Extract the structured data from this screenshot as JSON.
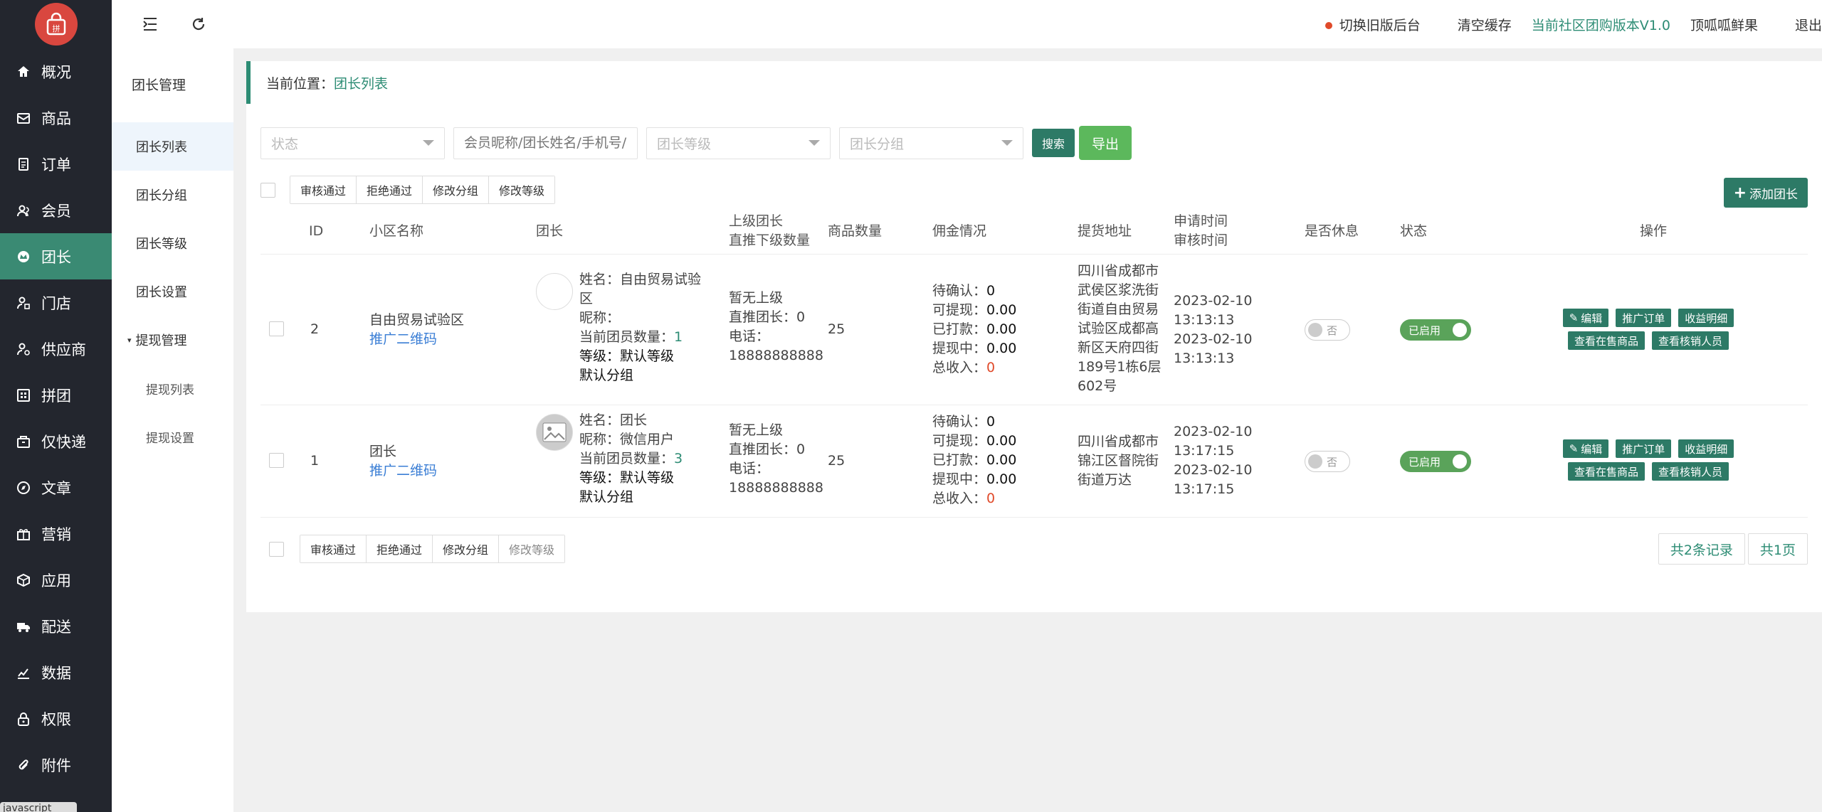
{
  "sidebar": {
    "items": [
      {
        "label": "概况",
        "icon": "home-icon"
      },
      {
        "label": "商品",
        "icon": "product-icon"
      },
      {
        "label": "订单",
        "icon": "order-icon"
      },
      {
        "label": "会员",
        "icon": "member-icon"
      },
      {
        "label": "团长",
        "icon": "leader-icon",
        "active": true
      },
      {
        "label": "门店",
        "icon": "store-icon"
      },
      {
        "label": "供应商",
        "icon": "supplier-icon"
      },
      {
        "label": "拼团",
        "icon": "groupbuy-icon"
      },
      {
        "label": "仅快递",
        "icon": "express-icon"
      },
      {
        "label": "文章",
        "icon": "article-icon"
      },
      {
        "label": "营销",
        "icon": "gift-icon"
      },
      {
        "label": "应用",
        "icon": "app-icon"
      },
      {
        "label": "配送",
        "icon": "truck-icon"
      },
      {
        "label": "数据",
        "icon": "chart-icon"
      },
      {
        "label": "权限",
        "icon": "lock-icon"
      },
      {
        "label": "附件",
        "icon": "attachment-icon"
      }
    ],
    "logo_text": "拼",
    "tooltip_stub": "javascript"
  },
  "submenu": {
    "title": "团长管理",
    "items": [
      "团长列表",
      "团长分组",
      "团长等级",
      "团长设置"
    ],
    "group": "提现管理",
    "group_children": [
      "提现列表",
      "提现设置"
    ]
  },
  "topbar": {
    "switch_old": "切换旧版后台",
    "clear_cache": "清空缓存",
    "version": "当前社区团购版本V1.0",
    "shop": "顶呱呱鲜果",
    "logout": "退出"
  },
  "breadcrumb": {
    "prefix": "当前位置：",
    "current": "团长列表"
  },
  "filters": {
    "status": "状态",
    "keyword_placeholder": "会员昵称/团长姓名/手机号/小区名称",
    "level": "团长等级",
    "group": "团长分组",
    "search": "搜索",
    "export": "导出"
  },
  "bulk": {
    "approve": "审核通过",
    "reject": "拒绝通过",
    "modify_group": "修改分组",
    "modify_level": "修改等级"
  },
  "add_button": "添加团长",
  "columns": {
    "id": "ID",
    "community": "小区名称",
    "leader": "团长",
    "upper_1": "上级团长",
    "upper_2": "直推下级数量",
    "goods_count": "商品数量",
    "commission": "佣金情况",
    "address": "提货地址",
    "time_1": "申请时间",
    "time_2": "审核时间",
    "rest": "是否休息",
    "status": "状态",
    "ops": "操作"
  },
  "rows": [
    {
      "id": "2",
      "community": "自由贸易试验区",
      "qrcode": "推广二维码",
      "name_line1": "姓名：自由贸易试验",
      "name_line2": "区",
      "nickname": "昵称：",
      "members_label": "当前团员数量：",
      "members": "1",
      "level_label": "等级：",
      "level": "默认等级",
      "group": "默认分组",
      "upper": "暂无上级",
      "direct_label": "直推团长：",
      "direct": "0",
      "phone_label": "电话：",
      "phone": "18888888888",
      "goods": "25",
      "pending_label": "待确认：",
      "pending": "0",
      "withdrawable_label": "可提现：",
      "withdrawable": "0.00",
      "paid_label": "已打款：",
      "paid": "0.00",
      "withdrawing_label": "提现中：",
      "withdrawing": "0.00",
      "total_label": "总收入：",
      "total": "0",
      "address_lines": [
        "四川省成都市",
        "武侯区浆洗街",
        "街道自由贸易",
        "试验区成都高",
        "新区天府四街",
        "189号1栋6层",
        "602号"
      ],
      "apply_date": "2023-02-10",
      "apply_time": "13:13:13",
      "audit_date": "2023-02-10",
      "audit_time": "13:13:13",
      "rest": "否",
      "status": "已启用"
    },
    {
      "id": "1",
      "community": "团长",
      "qrcode": "推广二维码",
      "name_line1": "姓名：团长",
      "name_line2": "",
      "nickname": "昵称：微信用户",
      "members_label": "当前团员数量：",
      "members": "3",
      "level_label": "等级：",
      "level": "默认等级",
      "group": "默认分组",
      "upper": "暂无上级",
      "direct_label": "直推团长：",
      "direct": "0",
      "phone_label": "电话：",
      "phone": "18888888888",
      "goods": "25",
      "pending_label": "待确认：",
      "pending": "0",
      "withdrawable_label": "可提现：",
      "withdrawable": "0.00",
      "paid_label": "已打款：",
      "paid": "0.00",
      "withdrawing_label": "提现中：",
      "withdrawing": "0.00",
      "total_label": "总收入：",
      "total": "0",
      "address_lines": [
        "四川省成都市",
        "锦江区督院街",
        "街道万达"
      ],
      "apply_date": "2023-02-10",
      "apply_time": "13:17:15",
      "audit_date": "2023-02-10",
      "audit_time": "13:17:15",
      "rest": "否",
      "status": "已启用"
    }
  ],
  "row_ops": {
    "edit": "编辑",
    "promo_orders": "推广订单",
    "income": "收益明细",
    "goods_on_sale": "查看在售商品",
    "verifiers": "查看核销人员"
  },
  "pager": {
    "total_records": "共2条记录",
    "total_pages": "共1页"
  },
  "colors": {
    "accent": "#2d8c74",
    "sidebar_bg": "#23262e",
    "active_nav": "#3a8a73",
    "logo": "#d9473f"
  }
}
